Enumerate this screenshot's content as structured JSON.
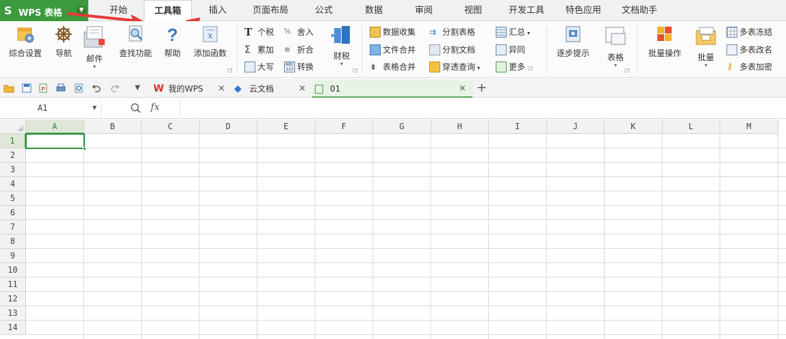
{
  "app": {
    "logo": "S",
    "title": "WPS 表格"
  },
  "menu_tabs": [
    {
      "label": "开始",
      "active": false
    },
    {
      "label": "工具箱",
      "active": true
    },
    {
      "label": "插入",
      "active": false
    },
    {
      "label": "页面布局",
      "active": false
    },
    {
      "label": "公式",
      "active": false
    },
    {
      "label": "数据",
      "active": false
    },
    {
      "label": "审阅",
      "active": false
    },
    {
      "label": "视图",
      "active": false
    },
    {
      "label": "开发工具",
      "active": false
    },
    {
      "label": "特色应用",
      "active": false
    },
    {
      "label": "文档助手",
      "active": false
    }
  ],
  "ribbon": {
    "big": {
      "comprehensive_settings": "综合设置",
      "navigation": "导航",
      "mail": "邮件",
      "find_function": "查找功能",
      "help": "帮助",
      "add_function": "添加函数",
      "tax": "财税",
      "step_prompt": "逐步提示",
      "table": "表格",
      "batch_operation": "批量操作",
      "batch": "批量"
    },
    "small": {
      "income_tax": "个税",
      "round": "舍入",
      "sum_add": "累加",
      "fold": "折合",
      "uppercase": "大写",
      "convert": "转换",
      "data_collect": "数据收集",
      "split_table": "分割表格",
      "file_merge": "文件合并",
      "split_doc": "分割文档",
      "table_merge": "表格合并",
      "pierce_query": "穿透查询",
      "summary": "汇总",
      "diff": "异同",
      "more": "更多",
      "multi_freeze": "多表冻结",
      "multi_rename": "多表改名",
      "multi_encrypt": "多表加密"
    }
  },
  "doc_tabs": [
    {
      "label": "我的WPS",
      "active": false
    },
    {
      "label": "云文档",
      "active": false
    },
    {
      "label": "01",
      "active": true
    }
  ],
  "formula_bar": {
    "name_box": "A1",
    "fx": "fx",
    "formula": ""
  },
  "grid": {
    "columns": [
      "A",
      "B",
      "C",
      "D",
      "E",
      "F",
      "G",
      "H",
      "I",
      "J",
      "K",
      "L",
      "M"
    ],
    "rows": [
      "1",
      "2",
      "3",
      "4",
      "5",
      "6",
      "7",
      "8",
      "9",
      "10",
      "11",
      "12",
      "13",
      "14"
    ],
    "active_cell": "A1"
  },
  "colors": {
    "brand_green": "#3c9a3e",
    "selection_green": "#2e8b3c",
    "annotation_red": "#e53935"
  }
}
